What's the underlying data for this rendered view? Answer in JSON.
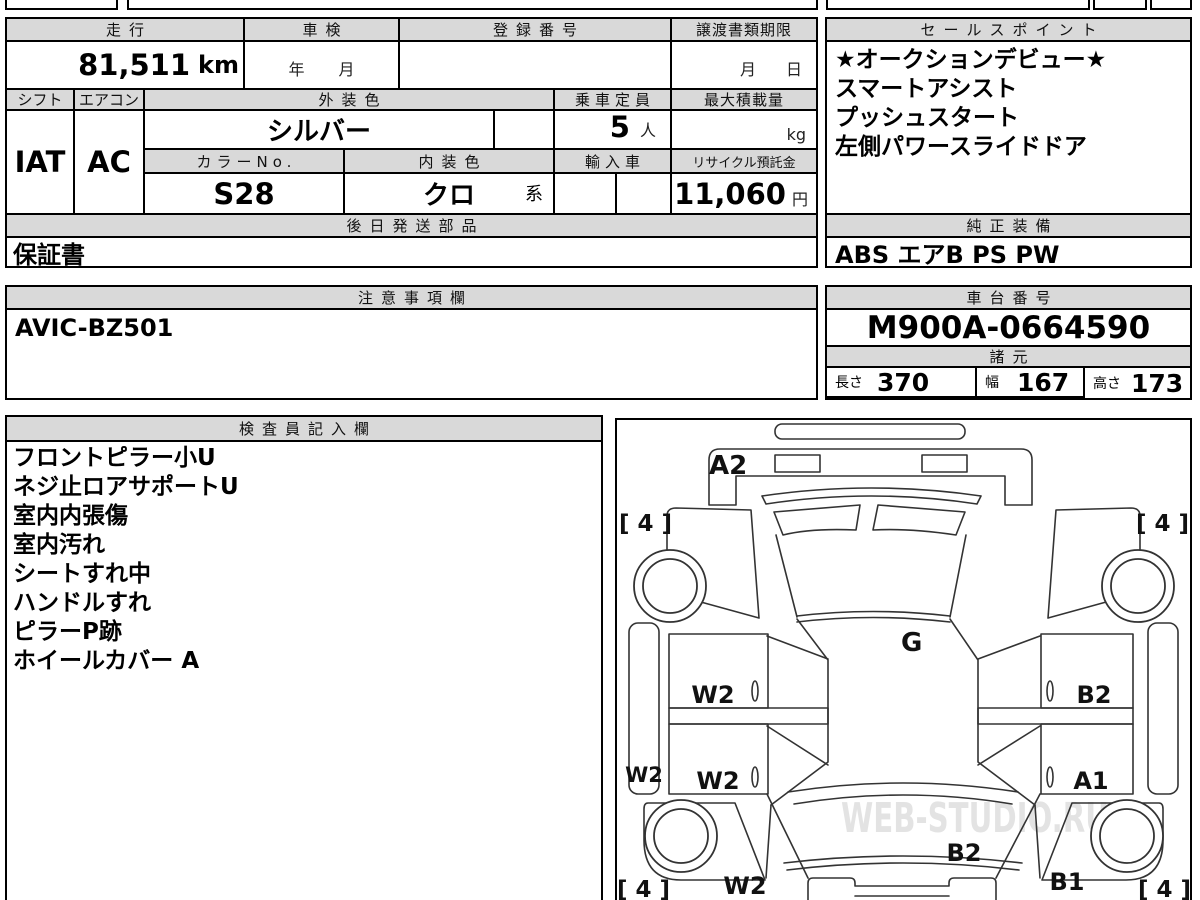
{
  "vehicle_table": {
    "mileage_label": "走行",
    "mileage_value": "81,511",
    "mileage_unit": "km",
    "shaken_label": "車検",
    "shaken_year": "年",
    "shaken_month": "月",
    "registration_label": "登録番号",
    "transfer_label": "譲渡書類期限",
    "transfer_month": "月",
    "transfer_day": "日",
    "shift_label": "シフト",
    "shift_value": "IAT",
    "aircon_label": "エアコン",
    "aircon_value": "AC",
    "exterior_label": "外装色",
    "exterior_value": "シルバー",
    "capacity_label": "乗車定員",
    "capacity_value": "5",
    "capacity_unit": "人",
    "maxload_label": "最大積載量",
    "maxload_unit": "kg",
    "colorno_label": "カラーNo.",
    "colorno_value": "S28",
    "interior_label": "内装色",
    "interior_value": "クロ",
    "interior_suffix": "系",
    "import_label": "輸入車",
    "recycle_label": "リサイクル預託金",
    "recycle_value": "11,060",
    "recycle_unit": "円",
    "parts_label": "後日発送部品",
    "parts_value": "保証書"
  },
  "sales_points": {
    "label": "セールスポイント",
    "items": [
      "★オークションデビュー★",
      "スマートアシスト",
      "プッシュスタート",
      "左側パワースライドドア"
    ]
  },
  "equipment": {
    "label": "純正装備",
    "value": "ABS エアB PS PW"
  },
  "notes": {
    "label": "注意事項欄",
    "value": "AVIC-BZ501"
  },
  "chassis": {
    "label": "車台番号",
    "value": "M900A-0664590"
  },
  "specs": {
    "label": "諸元",
    "length_label": "長さ",
    "length_value": "370",
    "width_label": "幅",
    "width_value": "167",
    "height_label": "高さ",
    "height_value": "173"
  },
  "inspector": {
    "label": "検査員記入欄",
    "items": [
      "フロントピラー小U",
      "ネジ止ロアサポートU",
      "室内内張傷",
      "室内汚れ",
      "シートすれ中",
      "ハンドルすれ",
      "ピラーP跡",
      "ホイールカバー A"
    ]
  },
  "diagram": {
    "front_panel": "A2",
    "roof": "G",
    "tire_front_left": "[ 4 ]",
    "tire_front_right": "[ 4 ]",
    "tire_rear_left": "[ 4 ]",
    "tire_rear_right": "[ 4 ]",
    "door_front_left": "W2",
    "door_rear_left": "W2",
    "sill_left": "W2",
    "quarter_rear_left": "W2",
    "door_front_right": "B2",
    "door_rear_right": "A1",
    "rear_hatch": "B2",
    "quarter_rear_right": "B1",
    "watermark": "WEB-STUDIO.RU"
  }
}
